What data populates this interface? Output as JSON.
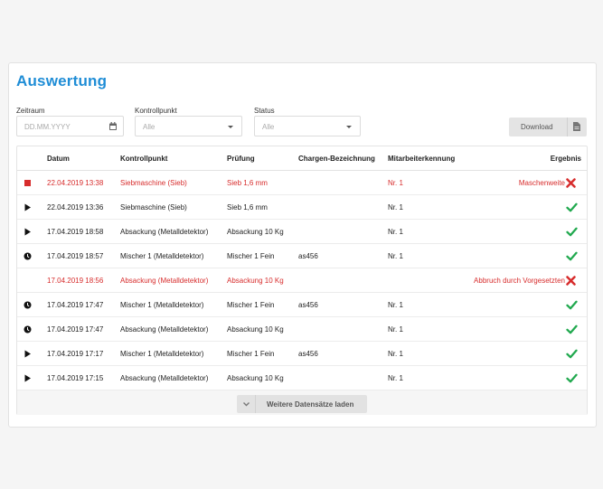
{
  "page": {
    "title": "Auswertung"
  },
  "filters": {
    "zeitraum": {
      "label": "Zeitraum",
      "placeholder": "DD.MM.YYYY"
    },
    "kontrollpunkt": {
      "label": "Kontrollpunkt",
      "value": "Alle"
    },
    "status": {
      "label": "Status",
      "value": "Alle"
    }
  },
  "toolbar": {
    "download_label": "Download"
  },
  "table": {
    "headers": {
      "datum": "Datum",
      "kontrollpunkt": "Kontrollpunkt",
      "pruefung": "Prüfung",
      "chargen": "Chargen-Bezeichnung",
      "mitarbeiter": "Mitarbeiterkennung",
      "ergebnis": "Ergebnis"
    },
    "rows": [
      {
        "status_icon": "stop-icon",
        "datum": "22.04.2019 13:38",
        "kontrollpunkt": "Siebmaschine (Sieb)",
        "pruefung": "Sieb 1,6 mm",
        "chargen": "",
        "mitarbeiter": "Nr. 1",
        "ergebnis": "Maschenweite",
        "result_icon": "cross-icon",
        "highlight": true
      },
      {
        "status_icon": "play-icon",
        "datum": "22.04.2019 13:36",
        "kontrollpunkt": "Siebmaschine (Sieb)",
        "pruefung": "Sieb 1,6 mm",
        "chargen": "",
        "mitarbeiter": "Nr. 1",
        "ergebnis": "",
        "result_icon": "check-icon",
        "highlight": false
      },
      {
        "status_icon": "play-icon",
        "datum": "17.04.2019 18:58",
        "kontrollpunkt": "Absackung (Metalldetektor)",
        "pruefung": "Absackung 10 Kg",
        "chargen": "",
        "mitarbeiter": "Nr. 1",
        "ergebnis": "",
        "result_icon": "check-icon",
        "highlight": false
      },
      {
        "status_icon": "clock-icon",
        "datum": "17.04.2019 18:57",
        "kontrollpunkt": "Mischer 1 (Metalldetektor)",
        "pruefung": "Mischer 1 Fein",
        "chargen": "as456",
        "mitarbeiter": "Nr. 1",
        "ergebnis": "",
        "result_icon": "check-icon",
        "highlight": false
      },
      {
        "status_icon": "",
        "datum": "17.04.2019 18:56",
        "kontrollpunkt": "Absackung (Metalldetektor)",
        "pruefung": "Absackung 10 Kg",
        "chargen": "",
        "mitarbeiter": "",
        "ergebnis": "Abbruch durch Vorgesetzten",
        "result_icon": "cross-icon",
        "highlight": true
      },
      {
        "status_icon": "clock-icon",
        "datum": "17.04.2019 17:47",
        "kontrollpunkt": "Mischer 1 (Metalldetektor)",
        "pruefung": "Mischer 1 Fein",
        "chargen": "as456",
        "mitarbeiter": "Nr. 1",
        "ergebnis": "",
        "result_icon": "check-icon",
        "highlight": false
      },
      {
        "status_icon": "clock-icon",
        "datum": "17.04.2019 17:47",
        "kontrollpunkt": "Absackung (Metalldetektor)",
        "pruefung": "Absackung 10 Kg",
        "chargen": "",
        "mitarbeiter": "Nr. 1",
        "ergebnis": "",
        "result_icon": "check-icon",
        "highlight": false
      },
      {
        "status_icon": "play-icon",
        "datum": "17.04.2019 17:17",
        "kontrollpunkt": "Mischer 1 (Metalldetektor)",
        "pruefung": "Mischer 1 Fein",
        "chargen": "as456",
        "mitarbeiter": "Nr. 1",
        "ergebnis": "",
        "result_icon": "check-icon",
        "highlight": false
      },
      {
        "status_icon": "play-icon",
        "datum": "17.04.2019 17:15",
        "kontrollpunkt": "Absackung (Metalldetektor)",
        "pruefung": "Absackung 10 Kg",
        "chargen": "",
        "mitarbeiter": "Nr. 1",
        "ergebnis": "",
        "result_icon": "check-icon",
        "highlight": false
      }
    ]
  },
  "load_more": {
    "label": "Weitere Datensätze laden"
  },
  "colors": {
    "accent": "#1f8dd6",
    "error": "#d72c2c",
    "success": "#21a94f"
  }
}
